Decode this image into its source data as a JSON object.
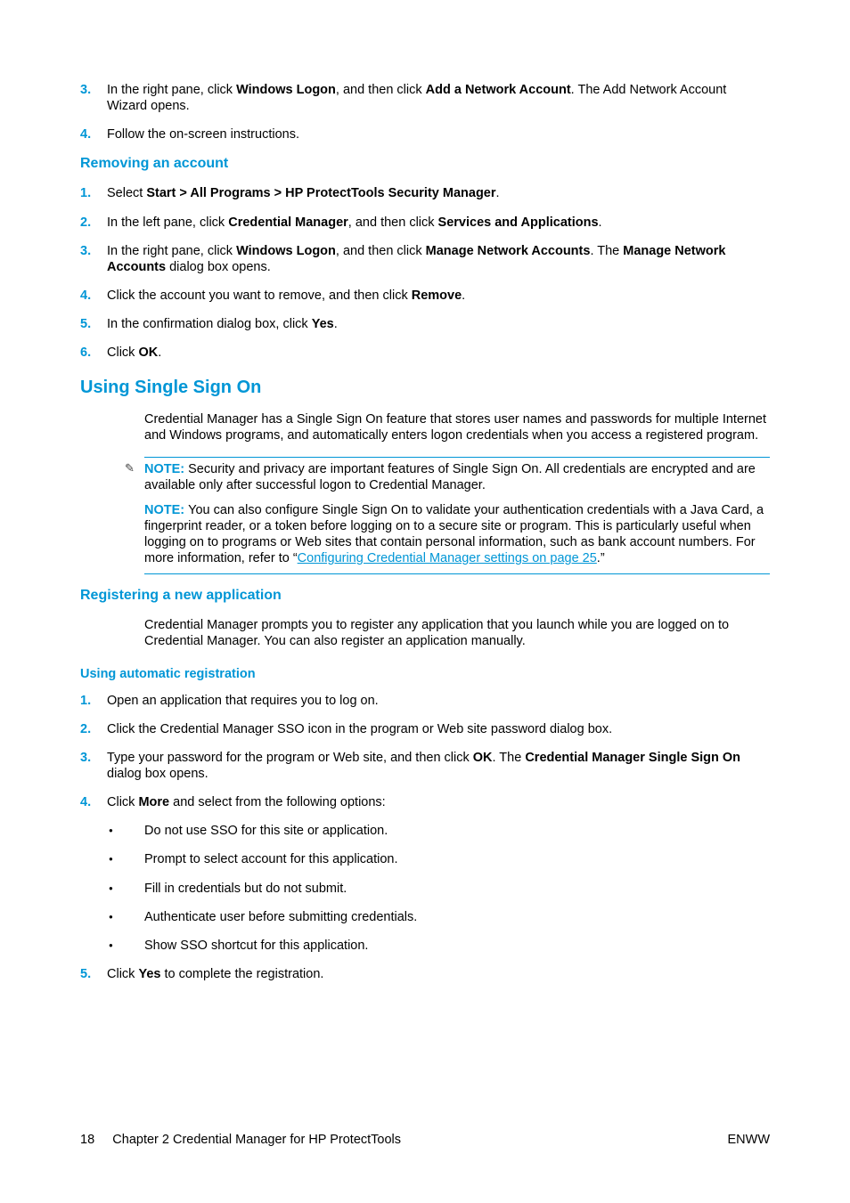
{
  "initialList": {
    "items": [
      {
        "num": "3.",
        "parts": [
          "In the right pane, click ",
          {
            "b": "Windows Logon"
          },
          ", and then click ",
          {
            "b": "Add a Network Account"
          },
          ". The Add Network Account Wizard opens."
        ]
      },
      {
        "num": "4.",
        "parts": [
          "Follow the on-screen instructions."
        ]
      }
    ]
  },
  "removing": {
    "heading": "Removing an account",
    "items": [
      {
        "num": "1.",
        "parts": [
          "Select ",
          {
            "b": "Start > All Programs > HP ProtectTools Security Manager"
          },
          "."
        ]
      },
      {
        "num": "2.",
        "parts": [
          "In the left pane, click ",
          {
            "b": "Credential Manager"
          },
          ", and then click ",
          {
            "b": "Services and Applications"
          },
          "."
        ]
      },
      {
        "num": "3.",
        "parts": [
          "In the right pane, click ",
          {
            "b": "Windows Logon"
          },
          ", and then click ",
          {
            "b": "Manage Network Accounts"
          },
          ". The ",
          {
            "b": "Manage Network Accounts"
          },
          " dialog box opens."
        ]
      },
      {
        "num": "4.",
        "parts": [
          "Click the account you want to remove, and then click ",
          {
            "b": "Remove"
          },
          "."
        ]
      },
      {
        "num": "5.",
        "parts": [
          "In the confirmation dialog box, click ",
          {
            "b": "Yes"
          },
          "."
        ]
      },
      {
        "num": "6.",
        "parts": [
          "Click ",
          {
            "b": "OK"
          },
          "."
        ]
      }
    ]
  },
  "sso": {
    "heading": "Using Single Sign On",
    "intro": "Credential Manager has a Single Sign On feature that stores user names and passwords for multiple Internet and Windows programs, and automatically enters logon credentials when you access a registered program.",
    "notes": [
      {
        "label": "NOTE:",
        "text": "Security and privacy are important features of Single Sign On. All credentials are encrypted and are available only after successful logon to Credential Manager.",
        "icon": true
      },
      {
        "label": "NOTE:",
        "text_before": "You can also configure Single Sign On to validate your authentication credentials with a Java Card, a fingerprint reader, or a token before logging on to a secure site or program. This is particularly useful when logging on to programs or Web sites that contain personal information, such as bank account numbers. For more information, refer to “",
        "link": "Configuring Credential Manager settings on page 25",
        "text_after": ".”",
        "icon": false
      }
    ]
  },
  "registering": {
    "heading": "Registering a new application",
    "intro": "Credential Manager prompts you to register any application that you launch while you are logged on to Credential Manager. You can also register an application manually."
  },
  "autoReg": {
    "heading": "Using automatic registration",
    "items": [
      {
        "num": "1.",
        "parts": [
          "Open an application that requires you to log on."
        ]
      },
      {
        "num": "2.",
        "parts": [
          "Click the Credential Manager SSO icon in the program or Web site password dialog box."
        ]
      },
      {
        "num": "3.",
        "parts": [
          "Type your password for the program or Web site, and then click ",
          {
            "b": "OK"
          },
          ". The ",
          {
            "b": "Credential Manager Single Sign On"
          },
          " dialog box opens."
        ]
      },
      {
        "num": "4.",
        "parts": [
          "Click ",
          {
            "b": "More"
          },
          " and select from the following options:"
        ],
        "bullets": [
          "Do not use SSO for this site or application.",
          "Prompt to select account for this application.",
          "Fill in credentials but do not submit.",
          "Authenticate user before submitting credentials.",
          "Show SSO shortcut for this application."
        ]
      },
      {
        "num": "5.",
        "parts": [
          "Click ",
          {
            "b": "Yes"
          },
          " to complete the registration."
        ]
      }
    ]
  },
  "footer": {
    "left_page": "18",
    "left_chapter": "Chapter 2   Credential Manager for HP ProtectTools",
    "right": "ENWW"
  }
}
